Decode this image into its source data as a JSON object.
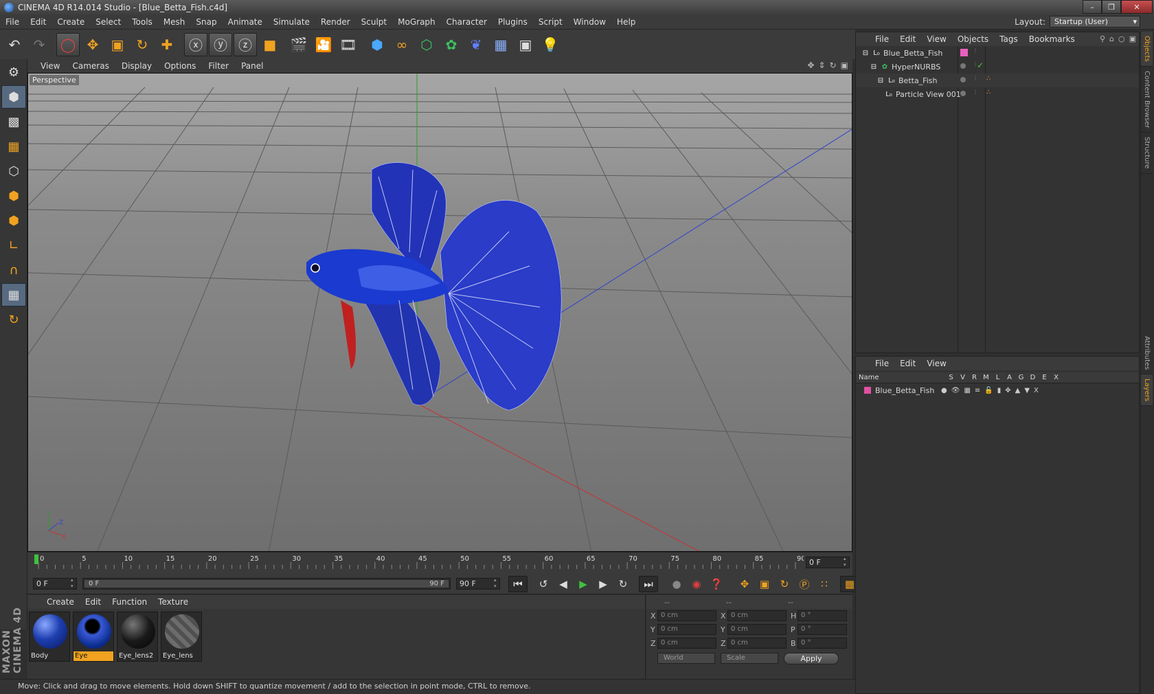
{
  "window": {
    "title": "CINEMA 4D R14.014 Studio - [Blue_Betta_Fish.c4d]",
    "minimize": "–",
    "maximize": "❐",
    "close": "✕"
  },
  "menu": [
    "File",
    "Edit",
    "Create",
    "Select",
    "Tools",
    "Mesh",
    "Snap",
    "Animate",
    "Simulate",
    "Render",
    "Sculpt",
    "MoGraph",
    "Character",
    "Plugins",
    "Script",
    "Window",
    "Help"
  ],
  "layout": {
    "label": "Layout:",
    "value": "Startup (User)"
  },
  "viewport": {
    "menu": [
      "View",
      "Cameras",
      "Display",
      "Options",
      "Filter",
      "Panel"
    ],
    "label": "Perspective",
    "axis": {
      "x": "X",
      "y": "Y",
      "z": "Z"
    }
  },
  "timeline": {
    "ticks": [
      "0",
      "5",
      "10",
      "15",
      "20",
      "25",
      "30",
      "35",
      "40",
      "45",
      "50",
      "55",
      "60",
      "65",
      "70",
      "75",
      "80",
      "85",
      "90"
    ],
    "current_frame": "0 F"
  },
  "transport": {
    "start": "0 F",
    "range_start": "0 F",
    "range_end": "90 F",
    "end": "90 F"
  },
  "materials": {
    "menu": [
      "Create",
      "Edit",
      "Function",
      "Texture"
    ],
    "items": [
      {
        "name": "Body",
        "selected": false,
        "color": "#1e3fb0"
      },
      {
        "name": "Eye",
        "selected": true,
        "color": "#0a2a8a"
      },
      {
        "name": "Eye_lens2",
        "selected": false,
        "color": "#1a1a1a"
      },
      {
        "name": "Eye_lens",
        "selected": false,
        "color": "#8a8a8a"
      }
    ]
  },
  "coords": {
    "headers": [
      "--",
      "--",
      "--"
    ],
    "rows": [
      {
        "a1": "X",
        "v1": "0 cm",
        "a2": "X",
        "v2": "0 cm",
        "a3": "H",
        "v3": "0 °"
      },
      {
        "a1": "Y",
        "v1": "0 cm",
        "a2": "Y",
        "v2": "0 cm",
        "a3": "P",
        "v3": "0 °"
      },
      {
        "a1": "Z",
        "v1": "0 cm",
        "a2": "Z",
        "v2": "0 cm",
        "a3": "B",
        "v3": "0 °"
      }
    ],
    "space": "World",
    "mode": "Scale",
    "apply": "Apply"
  },
  "objects": {
    "menu": [
      "File",
      "Edit",
      "View",
      "Objects",
      "Tags",
      "Bookmarks"
    ],
    "items": [
      {
        "name": "Blue_Betta_Fish",
        "depth": 0
      },
      {
        "name": "HyperNURBS",
        "depth": 1
      },
      {
        "name": "Betta_Fish",
        "depth": 2
      },
      {
        "name": "Particle View 001",
        "depth": 2
      }
    ]
  },
  "layers": {
    "menu": [
      "File",
      "Edit",
      "View"
    ],
    "columns": [
      "Name",
      "S",
      "V",
      "R",
      "M",
      "L",
      "A",
      "G",
      "D",
      "E",
      "X"
    ],
    "items": [
      {
        "name": "Blue_Betta_Fish",
        "color": "#e050a0"
      }
    ]
  },
  "side_tabs": [
    "Objects",
    "Content Browser",
    "Structure",
    "Attributes",
    "Layers"
  ],
  "brand": "MAXON CINEMA 4D",
  "status": "Move: Click and drag to move elements. Hold down SHIFT to quantize movement / add to the selection in point mode, CTRL to remove.",
  "colors": {
    "accent": "#f0a220",
    "fish": "#1e3fb0",
    "x_axis": "#c83232",
    "y_axis": "#2aa02a",
    "z_axis": "#3246c8"
  }
}
